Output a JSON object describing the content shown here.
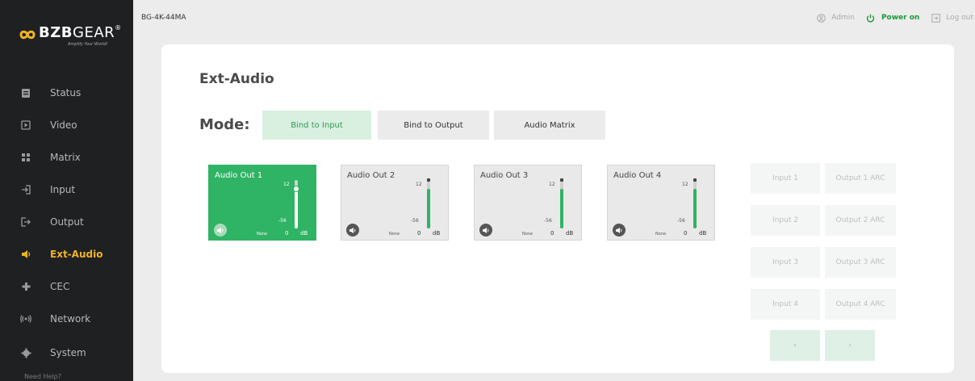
{
  "brand": {
    "name_bold": "BZB",
    "name_light": "GEAR",
    "trademark": "®",
    "tagline": "Amplify Your World!"
  },
  "sidebar": {
    "items": [
      {
        "label": "Status",
        "icon": "document-icon"
      },
      {
        "label": "Video",
        "icon": "play-icon"
      },
      {
        "label": "Matrix",
        "icon": "grid-icon"
      },
      {
        "label": "Input",
        "icon": "input-icon"
      },
      {
        "label": "Output",
        "icon": "output-icon"
      },
      {
        "label": "Ext-Audio",
        "icon": "speaker-icon",
        "active": true
      },
      {
        "label": "CEC",
        "icon": "gamepad-icon"
      },
      {
        "label": "Network",
        "icon": "signal-icon"
      },
      {
        "label": "System",
        "icon": "gear-icon"
      }
    ],
    "help": "Need Help?"
  },
  "header": {
    "device": "BG-4K-44MA",
    "user": "Admin",
    "power": "Power on",
    "logout": "Log out"
  },
  "colors": {
    "accent_green": "#2fb364",
    "active_nav": "#f0b323",
    "power_green": "#1a9a3b"
  },
  "main": {
    "title": "Ext-Audio",
    "mode_label": "Mode:",
    "modes": [
      {
        "label": "Bind to Input",
        "active": true
      },
      {
        "label": "Bind to Output",
        "active": false
      },
      {
        "label": "Audio Matrix",
        "active": false
      }
    ],
    "audio_outs": [
      {
        "title": "Audio Out 1",
        "max": "12",
        "min": "-56",
        "source": "None",
        "value": "0",
        "unit": "dB",
        "active": true,
        "level": 0.82
      },
      {
        "title": "Audio Out 2",
        "max": "12",
        "min": "-56",
        "source": "None",
        "value": "0",
        "unit": "dB",
        "active": false,
        "level": 0.82
      },
      {
        "title": "Audio Out 3",
        "max": "12",
        "min": "-56",
        "source": "None",
        "value": "0",
        "unit": "dB",
        "active": false,
        "level": 0.82
      },
      {
        "title": "Audio Out 4",
        "max": "12",
        "min": "-56",
        "source": "None",
        "value": "0",
        "unit": "dB",
        "active": false,
        "level": 0.82
      }
    ],
    "sources": [
      {
        "input": "Input 1",
        "output": "Output 1 ARC"
      },
      {
        "input": "Input 2",
        "output": "Output 2 ARC"
      },
      {
        "input": "Input 3",
        "output": "Output 3 ARC"
      },
      {
        "input": "Input 4",
        "output": "Output 4 ARC"
      }
    ],
    "pager": {
      "prev": "‹",
      "next": "›"
    }
  }
}
